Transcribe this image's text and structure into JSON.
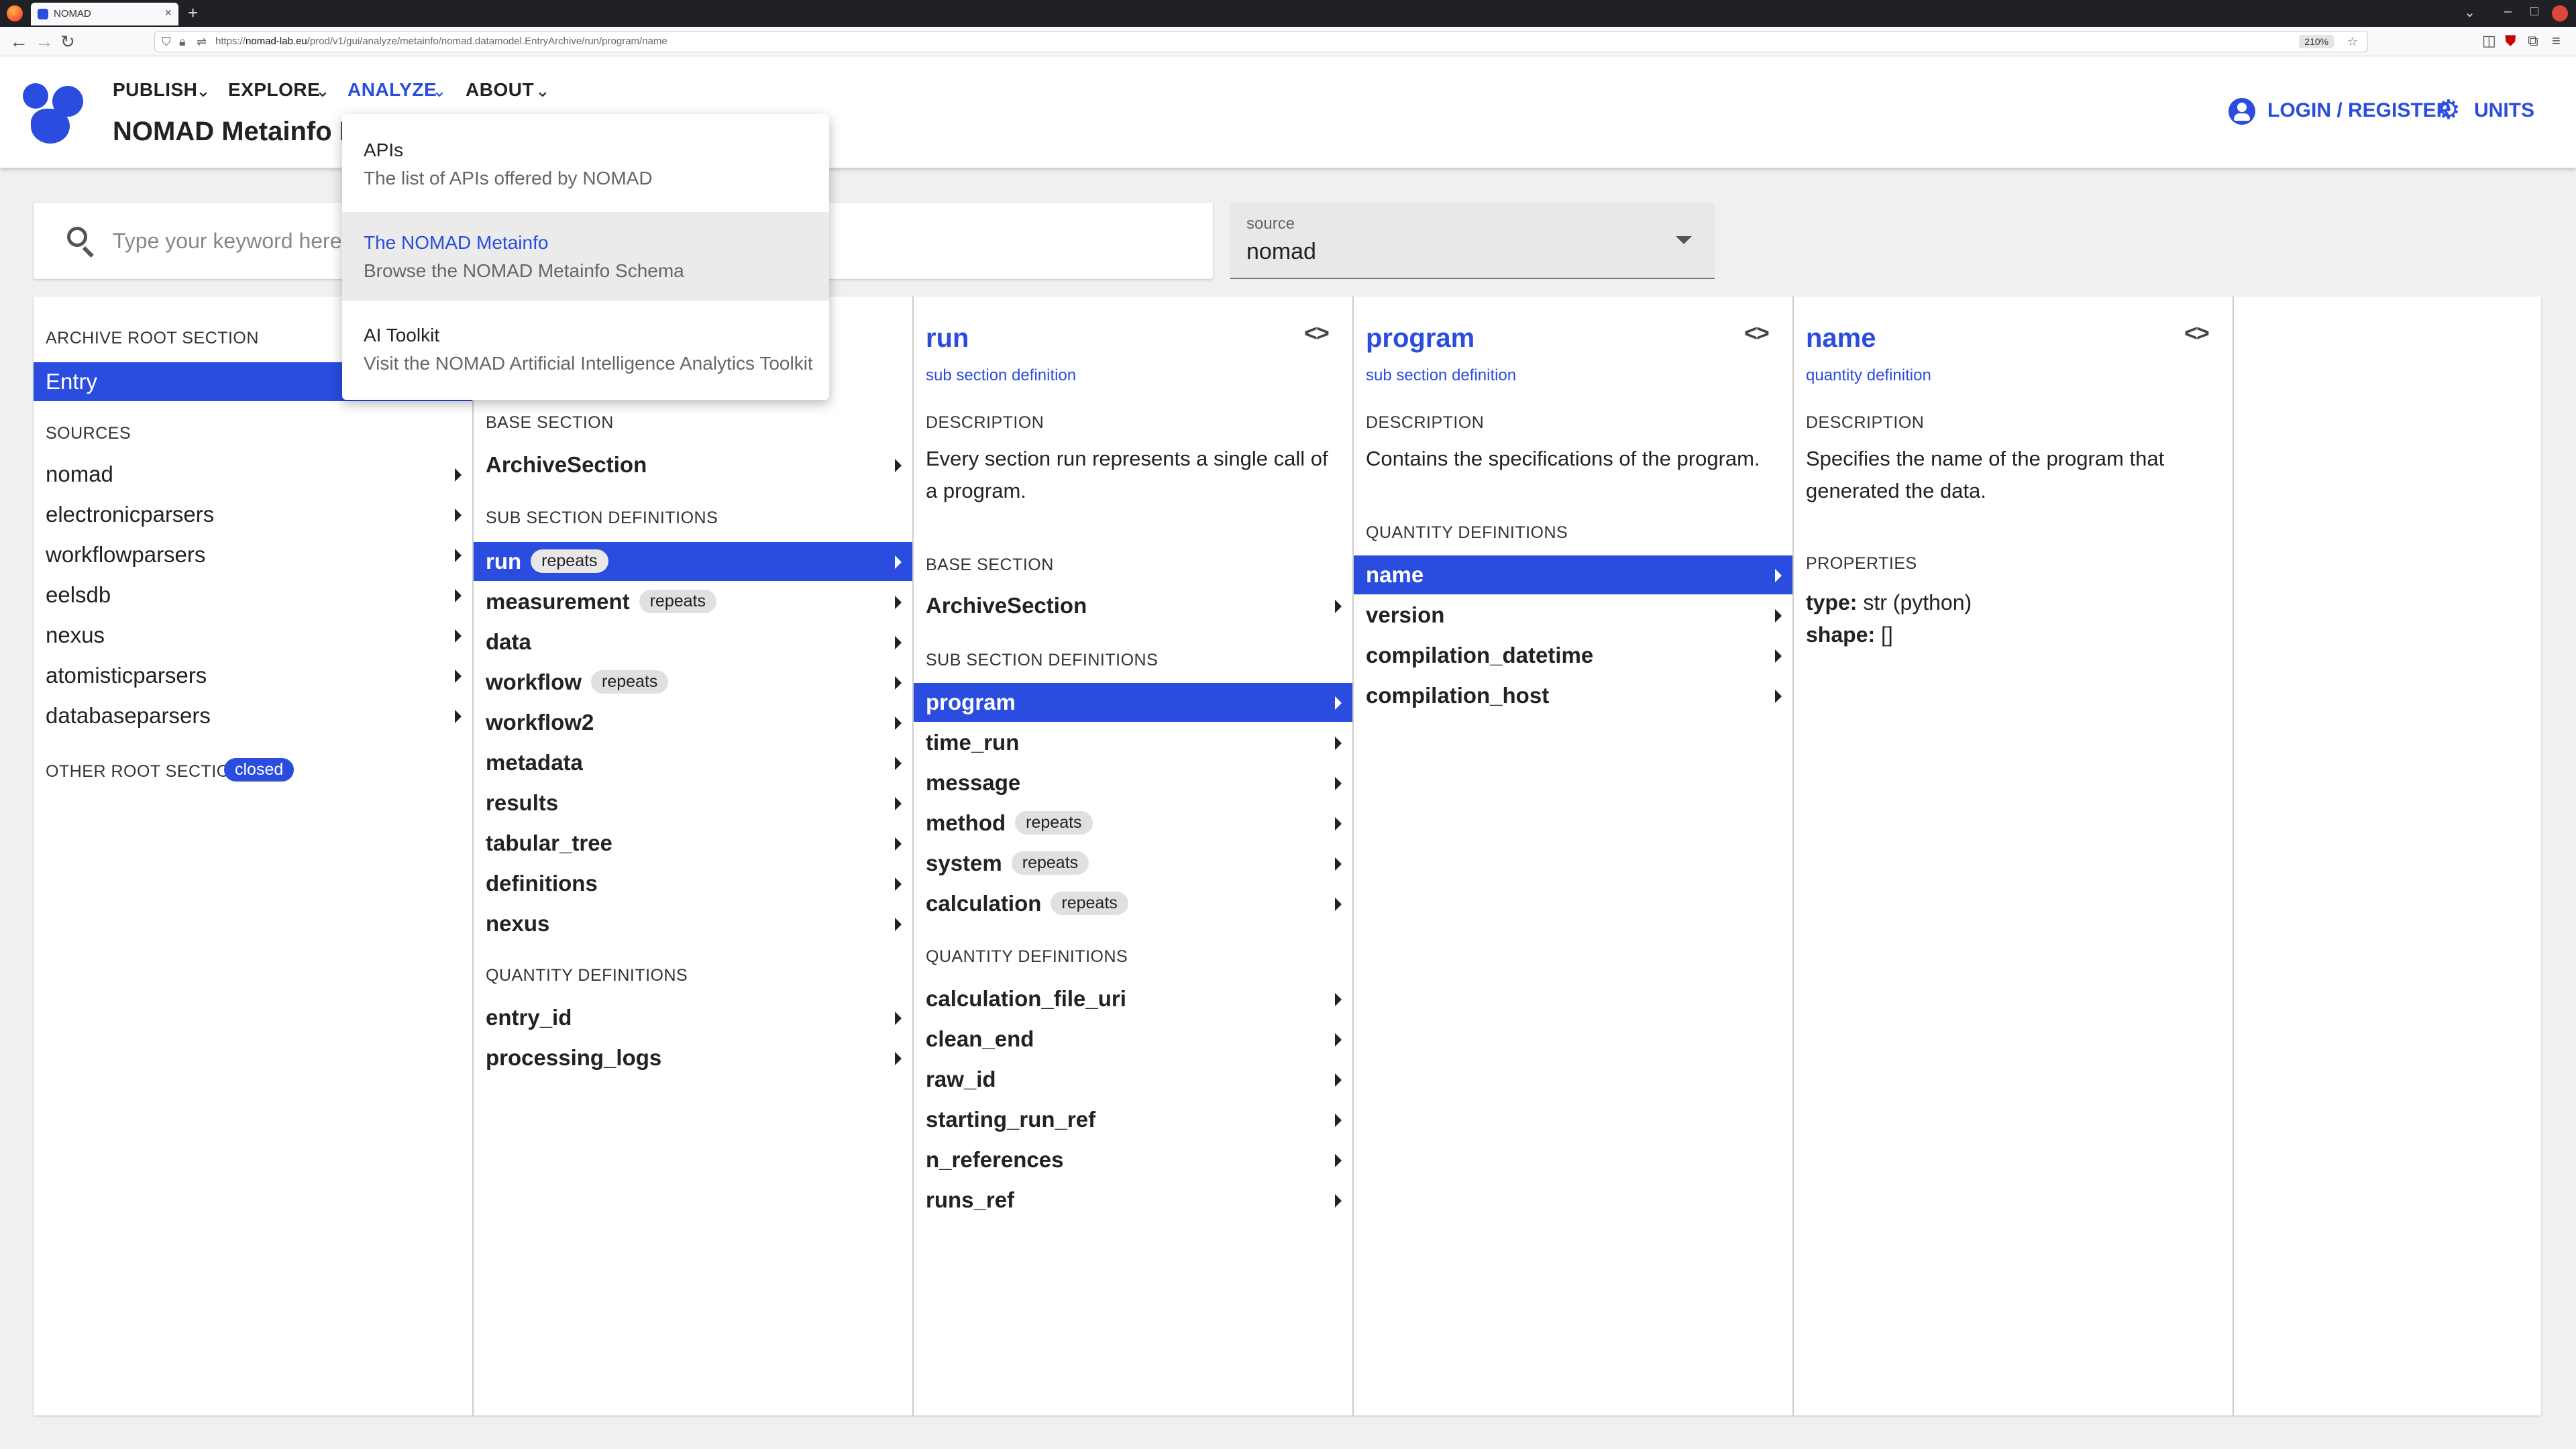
{
  "browser": {
    "tab_title": "NOMAD",
    "url_host": "nomad-lab.eu",
    "url_path": "/prod/v1/gui/analyze/metainfo/nomad.datamodel.EntryArchive/run/program/name",
    "url_prefix": "https://",
    "zoom": "210%"
  },
  "header": {
    "menu": [
      {
        "label": "PUBLISH"
      },
      {
        "label": "EXPLORE"
      },
      {
        "label": "ANALYZE"
      },
      {
        "label": "ABOUT"
      }
    ],
    "page_title": "NOMAD Metainfo B",
    "login_label": "LOGIN / REGISTER",
    "units_label": "UNITS"
  },
  "search": {
    "placeholder": "Type your keyword here",
    "source_label": "source",
    "source_value": "nomad"
  },
  "dropdown": {
    "items": [
      {
        "title": "APIs",
        "description": "The list of APIs offered by NOMAD"
      },
      {
        "title": "The NOMAD Metainfo",
        "description": "Browse the NOMAD Metainfo Schema"
      },
      {
        "title": "AI Toolkit",
        "description": "Visit the NOMAD Artificial Intelligence Analytics Toolkit"
      }
    ]
  },
  "col1": {
    "root_title": "ARCHIVE ROOT SECTION",
    "root_item": "Entry",
    "sources_title": "SOURCES",
    "sources": [
      "nomad",
      "electronicparsers",
      "workflowparsers",
      "eelsdb",
      "nexus",
      "atomisticparsers",
      "databaseparsers"
    ],
    "other_title": "OTHER ROOT SECTIONS",
    "closed_chip": "closed"
  },
  "col2": {
    "base_title": "BASE SECTION",
    "base_item": "ArchiveSection",
    "sub_title": "SUB SECTION DEFINITIONS",
    "sub_items": [
      {
        "label": "run",
        "chip": "repeats"
      },
      {
        "label": "measurement",
        "chip": "repeats"
      },
      {
        "label": "data",
        "chip": ""
      },
      {
        "label": "workflow",
        "chip": "repeats"
      },
      {
        "label": "workflow2",
        "chip": ""
      },
      {
        "label": "metadata",
        "chip": ""
      },
      {
        "label": "results",
        "chip": ""
      },
      {
        "label": "tabular_tree",
        "chip": ""
      },
      {
        "label": "definitions",
        "chip": ""
      },
      {
        "label": "nexus",
        "chip": ""
      }
    ],
    "qty_title": "QUANTITY DEFINITIONS",
    "qty_items": [
      "entry_id",
      "processing_logs"
    ]
  },
  "col3": {
    "head": "run",
    "sub": "sub section definition",
    "desc_title": "DESCRIPTION",
    "description": "Every section run represents a single call of a program.",
    "base_title": "BASE SECTION",
    "base_item": "ArchiveSection",
    "sub_title": "SUB SECTION DEFINITIONS",
    "sub_items": [
      {
        "label": "program",
        "chip": ""
      },
      {
        "label": "time_run",
        "chip": ""
      },
      {
        "label": "message",
        "chip": ""
      },
      {
        "label": "method",
        "chip": "repeats"
      },
      {
        "label": "system",
        "chip": "repeats"
      },
      {
        "label": "calculation",
        "chip": "repeats"
      }
    ],
    "qty_title": "QUANTITY DEFINITIONS",
    "qty_items": [
      "calculation_file_uri",
      "clean_end",
      "raw_id",
      "starting_run_ref",
      "n_references",
      "runs_ref"
    ]
  },
  "col4": {
    "head": "program",
    "sub": "sub section definition",
    "desc_title": "DESCRIPTION",
    "description": "Contains the specifications of the program.",
    "qty_title": "QUANTITY DEFINITIONS",
    "qty_items": [
      "name",
      "version",
      "compilation_datetime",
      "compilation_host"
    ]
  },
  "col5": {
    "head": "name",
    "sub": "quantity definition",
    "desc_title": "DESCRIPTION",
    "description": "Specifies the name of the program that generated the data.",
    "props_title": "PROPERTIES",
    "type_key": "type:",
    "type_value": "str (python)",
    "shape_key": "shape:",
    "shape_value": "[]"
  },
  "colors": {
    "accent": "#2a4cdf",
    "chip": "#e0e0e0"
  },
  "icons": {
    "logo": "nomad-logo",
    "user": "account-circle-icon",
    "units": "gear-icon",
    "search": "search-icon",
    "code": "code-brackets-icon"
  }
}
